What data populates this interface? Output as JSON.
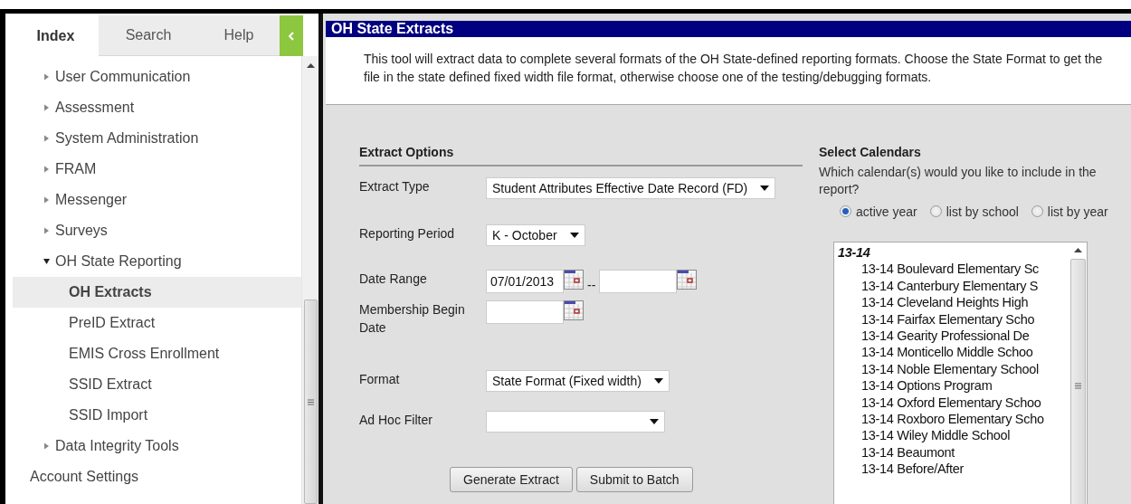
{
  "sidebar": {
    "tabs": [
      {
        "label": "Index",
        "selected": true
      },
      {
        "label": "Search",
        "selected": false
      },
      {
        "label": "Help",
        "selected": false
      }
    ],
    "items": [
      {
        "kind": "folder",
        "label": "User Communication",
        "expanded": false
      },
      {
        "kind": "folder",
        "label": "Assessment",
        "expanded": false
      },
      {
        "kind": "folder",
        "label": "System Administration",
        "expanded": false
      },
      {
        "kind": "folder",
        "label": "FRAM",
        "expanded": false
      },
      {
        "kind": "folder",
        "label": "Messenger",
        "expanded": false
      },
      {
        "kind": "folder",
        "label": "Surveys",
        "expanded": false
      },
      {
        "kind": "folder",
        "label": "OH State Reporting",
        "expanded": true,
        "children": [
          {
            "label": "OH Extracts",
            "selected": true
          },
          {
            "label": "PreID Extract",
            "selected": false
          },
          {
            "label": "EMIS Cross Enrollment",
            "selected": false
          },
          {
            "label": "SSID Extract",
            "selected": false
          },
          {
            "label": "SSID Import",
            "selected": false
          }
        ]
      },
      {
        "kind": "folder",
        "label": "Data Integrity Tools",
        "expanded": false
      },
      {
        "kind": "link",
        "label": "Account Settings",
        "selected": false
      }
    ]
  },
  "main": {
    "title": "OH State Extracts",
    "description": "This tool will extract data to complete several formats of the OH State-defined reporting formats. Choose the State Format to get the file in the state defined fixed width file format, otherwise choose one of the testing/debugging formats.",
    "extract_options": {
      "title": "Extract Options",
      "fields": [
        {
          "kind": "select",
          "label": "Extract Type",
          "value": "Student Attributes Effective Date Record (FD)"
        },
        {
          "kind": "select",
          "label": "Reporting Period",
          "value": "K - October"
        },
        {
          "kind": "date_range",
          "label": "Date Range",
          "value": "07/01/2013",
          "separator": "--"
        },
        {
          "kind": "date",
          "label": "Membership Begin Date"
        },
        {
          "kind": "select",
          "label": "Format",
          "value": "State Format (Fixed width)"
        },
        {
          "kind": "select",
          "label": "Ad Hoc Filter"
        }
      ],
      "buttons": [
        "Generate Extract",
        "Submit to Batch"
      ]
    },
    "calendars": {
      "title": "Select Calendars",
      "question": "Which calendar(s) would you like to include in the report?",
      "radios": [
        {
          "label": "active year",
          "selected": true
        },
        {
          "label": "list by school",
          "selected": false
        },
        {
          "label": "list by year",
          "selected": false
        }
      ],
      "group": "13-14",
      "items": [
        "13-14 Boulevard Elementary Sc",
        "13-14 Canterbury Elementary S",
        "13-14 Cleveland Heights High",
        "13-14 Fairfax Elementary Scho",
        "13-14 Gearity Professional De",
        "13-14 Monticello Middle Schoo",
        "13-14 Noble Elementary School",
        "13-14 Options Program",
        "13-14 Oxford Elementary Schoo",
        "13-14 Roxboro Elementary Scho",
        "13-14 Wiley Middle School",
        "13-14 Beaumont",
        "13-14 Before/After"
      ]
    }
  }
}
